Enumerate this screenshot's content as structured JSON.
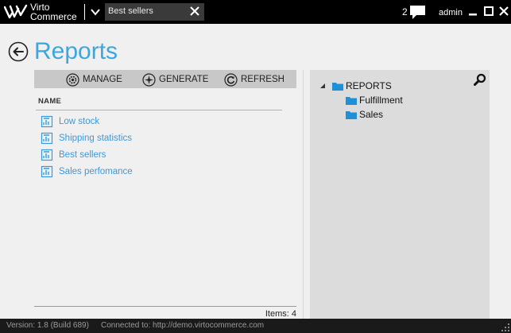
{
  "app": {
    "logo_line1": "Virto",
    "logo_line2": "Commerce"
  },
  "tab": {
    "label": "Best sellers"
  },
  "header": {
    "notification_count": "2",
    "user_name": "admin"
  },
  "page": {
    "title": "Reports"
  },
  "toolbar": {
    "manage": "MANAGE",
    "generate": "GENERATE",
    "refresh": "REFRESH"
  },
  "list": {
    "column_header": "NAME",
    "items": [
      {
        "label": "Low stock"
      },
      {
        "label": "Shipping statistics"
      },
      {
        "label": "Best sellers"
      },
      {
        "label": "Sales perfomance"
      }
    ],
    "count_text": "Items: 4"
  },
  "tree": {
    "root": "REPORTS",
    "children": [
      "Fulfillment",
      "Sales"
    ]
  },
  "status": {
    "version": "Version: 1.8 (Build 689)",
    "connection": "Connected to: http://demo.virtocommerce.com"
  },
  "colors": {
    "accent": "#3aa7e0",
    "folder": "#1e90d6",
    "link": "#3a9ad9"
  },
  "icons": {
    "logo": "virto-logo-icon",
    "menu": "chevron-down-icon",
    "tab_close": "close-icon",
    "notifications": "speech-bubble-icon",
    "back": "back-arrow-icon",
    "manage": "gear-icon",
    "generate": "sparkle-icon",
    "refresh": "refresh-icon",
    "report": "report-document-icon",
    "search": "search-icon",
    "folder": "folder-icon"
  }
}
